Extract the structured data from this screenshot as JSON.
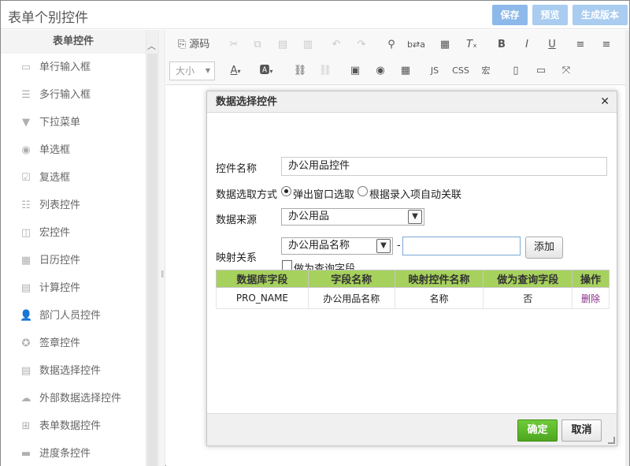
{
  "header": {
    "title": "表单个别控件",
    "save": "保存",
    "preview": "预览",
    "generate": "生成版本"
  },
  "sidebar": {
    "heading": "表单控件",
    "items": [
      {
        "label": "单行输入框",
        "icon": "single-line-input-icon"
      },
      {
        "label": "多行输入框",
        "icon": "multi-line-input-icon"
      },
      {
        "label": "下拉菜单",
        "icon": "dropdown-icon"
      },
      {
        "label": "单选框",
        "icon": "radio-icon"
      },
      {
        "label": "复选框",
        "icon": "checkbox-icon"
      },
      {
        "label": "列表控件",
        "icon": "list-icon"
      },
      {
        "label": "宏控件",
        "icon": "macro-icon"
      },
      {
        "label": "日历控件",
        "icon": "calendar-icon"
      },
      {
        "label": "计算控件",
        "icon": "calculator-icon"
      },
      {
        "label": "部门人员控件",
        "icon": "user-icon"
      },
      {
        "label": "签章控件",
        "icon": "seal-icon"
      },
      {
        "label": "数据选择控件",
        "icon": "data-select-icon"
      },
      {
        "label": "外部数据选择控件",
        "icon": "cloud-icon"
      },
      {
        "label": "表单数据控件",
        "icon": "form-data-icon"
      },
      {
        "label": "进度条控件",
        "icon": "progress-icon"
      }
    ]
  },
  "toolbar": {
    "source": "源码",
    "font_size": "大小",
    "js": "JS",
    "css": "CSS",
    "macro": "宏"
  },
  "dialog": {
    "title": "数据选择控件",
    "name_label": "控件名称",
    "name_value": "办公用品控件",
    "mode_label": "数据选取方式",
    "mode_popup": "弹出窗口选取",
    "mode_auto": "根据录入项自动关联",
    "source_label": "数据来源",
    "source_value": "办公用品",
    "mapping_label": "映射关系",
    "mapping_field": "办公用品名称",
    "mapping_sep": "-",
    "mapping_target": "",
    "add": "添加",
    "query_field": "做为查询字段",
    "table": {
      "headers": [
        "数据库字段",
        "字段名称",
        "映射控件名称",
        "做为查询字段",
        "操作"
      ],
      "rows": [
        [
          "PRO_NAME",
          "办公用品名称",
          "名称",
          "否",
          "删除"
        ]
      ]
    },
    "ok": "确定",
    "cancel": "取消"
  }
}
